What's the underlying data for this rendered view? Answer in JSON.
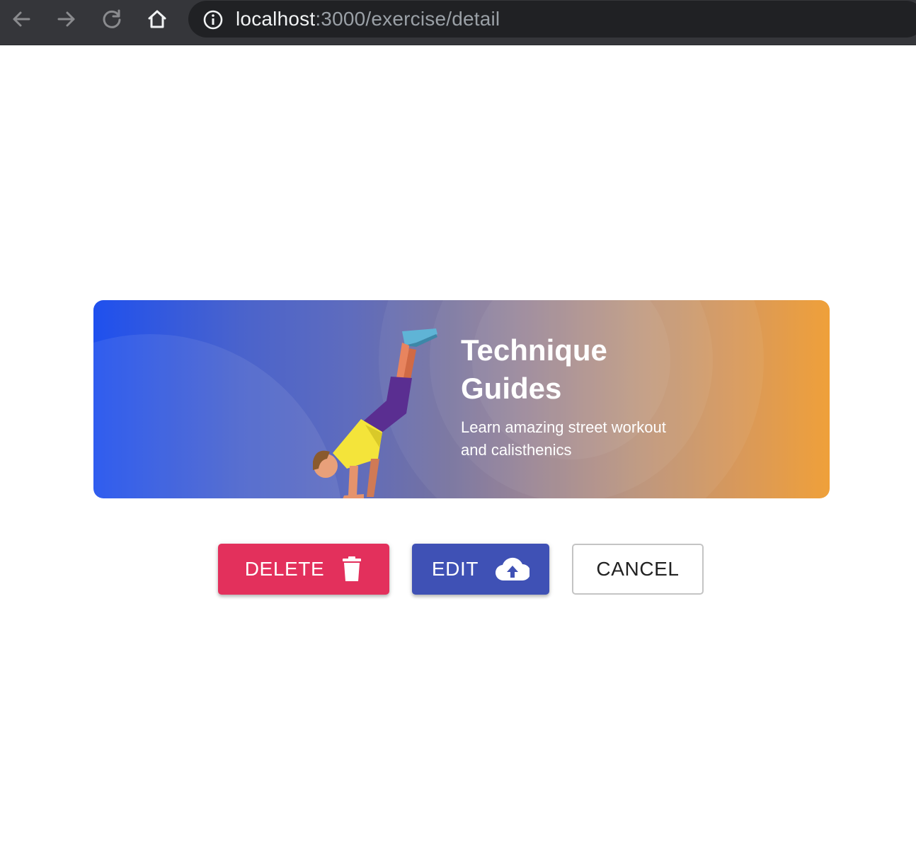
{
  "browser": {
    "url_host": "localhost",
    "url_path": ":3000/exercise/detail",
    "icons": {
      "back": "arrow-left-icon",
      "forward": "arrow-right-icon",
      "reload": "reload-icon",
      "home": "home-icon",
      "site_info": "info-icon"
    }
  },
  "banner": {
    "title_line1": "Technique",
    "title_line2": "Guides",
    "subtitle_line1": "Learn amazing street workout",
    "subtitle_line2": "and calisthenics",
    "gradient": [
      "#1f50ee",
      "#efa03a"
    ]
  },
  "actions": {
    "delete_label": "DELETE",
    "delete_icon": "trash-icon",
    "edit_label": "EDIT",
    "edit_icon": "cloud-upload-icon",
    "cancel_label": "CANCEL"
  },
  "colors": {
    "delete": "#e3305c",
    "edit": "#3f51b5",
    "cancel_border": "#c4c4c4"
  }
}
